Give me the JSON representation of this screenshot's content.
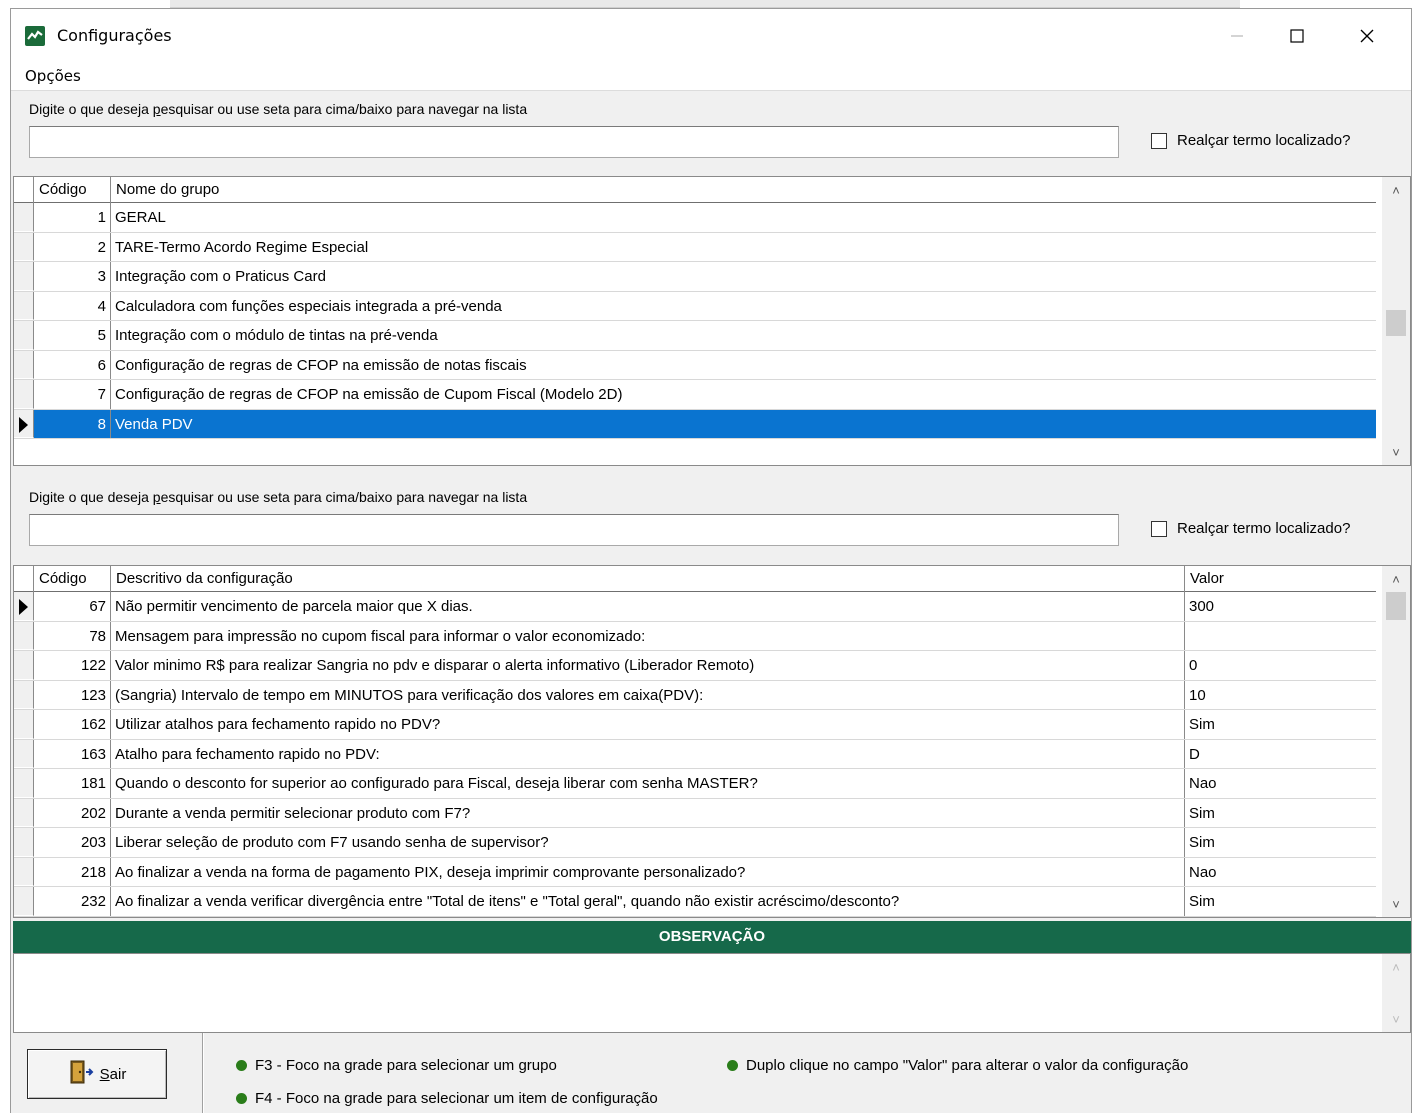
{
  "window": {
    "title": "Configurações",
    "menu": "Opções"
  },
  "search_top": {
    "label_pre": "Digite o que deseja ",
    "label_key": "p",
    "label_post": "esquisar ou use seta para cima/baixo para navegar na lista",
    "value": "",
    "checkbox_label": "Realçar termo localizado?"
  },
  "groups": {
    "columns": [
      "Código",
      "Nome do grupo"
    ],
    "rows": [
      {
        "code": "1",
        "name": "GERAL"
      },
      {
        "code": "2",
        "name": "TARE-Termo Acordo Regime Especial"
      },
      {
        "code": "3",
        "name": "Integração com o Praticus Card"
      },
      {
        "code": "4",
        "name": "Calculadora com funções especiais integrada a pré-venda"
      },
      {
        "code": "5",
        "name": "Integração com o módulo de tintas na pré-venda"
      },
      {
        "code": "6",
        "name": "Configuração de regras de CFOP na emissão de notas fiscais"
      },
      {
        "code": "7",
        "name": "Configuração de regras de CFOP na emissão de Cupom Fiscal (Modelo 2D)"
      },
      {
        "code": "8",
        "name": "Venda PDV"
      }
    ]
  },
  "search_bottom": {
    "label_pre": "Digite o que deseja ",
    "label_key": "p",
    "label_post": "esquisar ou use seta para cima/baixo para navegar na lista",
    "value": "",
    "checkbox_label": "Realçar termo localizado?"
  },
  "configs": {
    "columns": [
      "Código",
      "Descritivo da configuração",
      "Valor"
    ],
    "rows": [
      {
        "code": "67",
        "desc": "Não permitir vencimento de parcela maior que X dias.",
        "value": "300"
      },
      {
        "code": "78",
        "desc": "Mensagem para impressão no cupom fiscal para informar o valor economizado:",
        "value": ""
      },
      {
        "code": "122",
        "desc": "Valor minimo R$ para realizar Sangria no pdv e disparar o alerta informativo (Liberador Remoto)",
        "value": "0"
      },
      {
        "code": "123",
        "desc": "(Sangria) Intervalo de tempo em MINUTOS para verificação dos valores em caixa(PDV):",
        "value": "10"
      },
      {
        "code": "162",
        "desc": "Utilizar atalhos para fechamento rapido no PDV?",
        "value": "Sim"
      },
      {
        "code": "163",
        "desc": "Atalho para fechamento rapido no PDV:",
        "value": "D"
      },
      {
        "code": "181",
        "desc": "Quando o desconto for superior ao configurado para Fiscal, deseja liberar com senha MASTER?",
        "value": "Nao"
      },
      {
        "code": "202",
        "desc": "Durante a venda permitir selecionar produto com F7?",
        "value": "Sim"
      },
      {
        "code": "203",
        "desc": "Liberar seleção de produto com F7 usando senha de supervisor?",
        "value": "Sim"
      },
      {
        "code": "218",
        "desc": "Ao finalizar a venda na forma de pagamento PIX, deseja imprimir comprovante personalizado?",
        "value": "Nao"
      },
      {
        "code": "232",
        "desc": "Ao finalizar a venda verificar divergência entre \"Total de itens\" e \"Total geral\", quando não existir acréscimo/desconto?",
        "value": "Sim"
      }
    ]
  },
  "observation": {
    "title": "OBSERVAÇÃO",
    "text": ""
  },
  "footer": {
    "exit_label_key": "S",
    "exit_label_rest": "air",
    "hints": [
      "F3 - Foco na grade para selecionar um grupo",
      "F4 - Foco na grade para selecionar um item de configuração",
      "Duplo clique no campo \"Valor\" para alterar o valor da configuração"
    ]
  },
  "colors": {
    "selection": "#0a74d0",
    "observation_bar": "#16694a",
    "hint_dot": "#2a7d1a"
  }
}
